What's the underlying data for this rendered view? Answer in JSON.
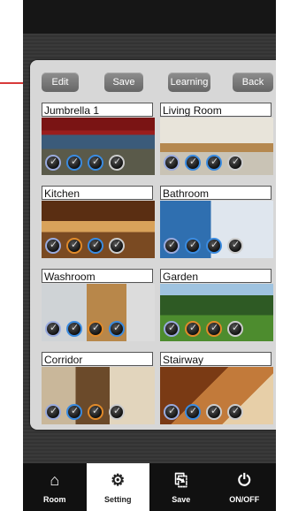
{
  "toolbar": {
    "edit": "Edit",
    "save": "Save",
    "learning": "Learning",
    "back": "Back"
  },
  "rooms": [
    {
      "name": "Jumbrella 1"
    },
    {
      "name": "Living Room"
    },
    {
      "name": "Kitchen"
    },
    {
      "name": "Bathroom"
    },
    {
      "name": "Washroom"
    },
    {
      "name": "Garden"
    },
    {
      "name": "Corridor"
    },
    {
      "name": "Stairway"
    }
  ],
  "tabs": [
    {
      "label": "Room",
      "icon": "home-icon"
    },
    {
      "label": "Setting",
      "icon": "gear-icon",
      "active": true
    },
    {
      "label": "Save",
      "icon": "save-icon"
    },
    {
      "label": "ON/OFF",
      "icon": "power-icon"
    }
  ]
}
